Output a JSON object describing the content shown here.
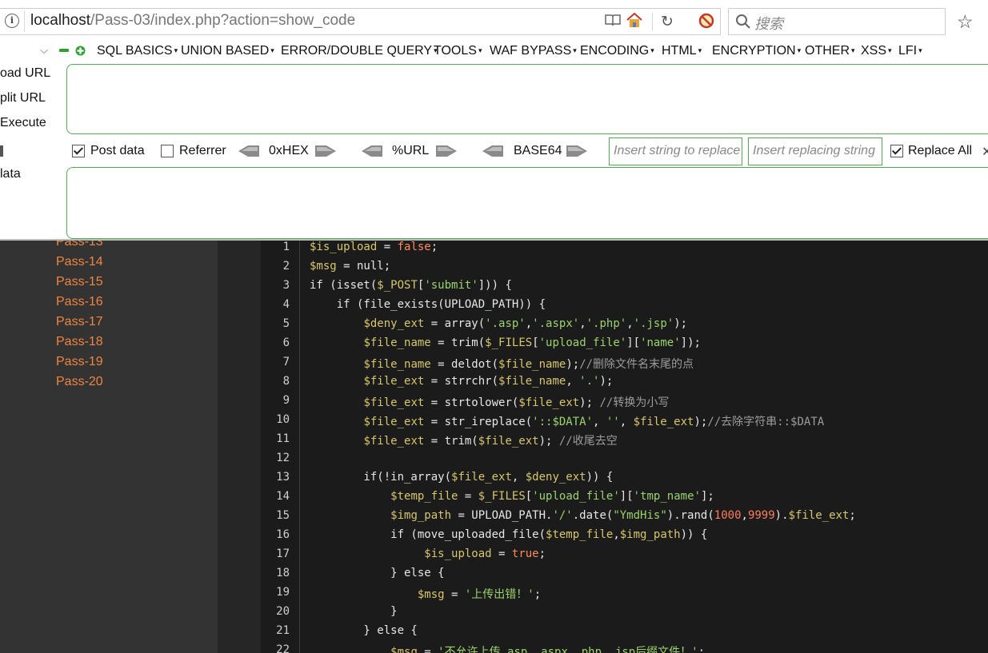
{
  "address_bar": {
    "url_host": "localhost",
    "url_path": "/Pass-03/index.php?action=show_code",
    "search_placeholder": "搜索"
  },
  "hackbar": {
    "menus": [
      "SQL BASICS",
      "UNION BASED",
      "ERROR/DOUBLE QUERY",
      "TOOLS",
      "WAF BYPASS",
      "ENCODING",
      "HTML",
      "ENCRYPTION",
      "OTHER",
      "XSS",
      "LFI"
    ],
    "actions": {
      "load_url": "oad URL",
      "split_url": "plit URL",
      "execute": "Execute",
      "post_data": "lata"
    },
    "options": {
      "post_data": "Post data",
      "referrer": "Referrer",
      "hex": "0xHEX",
      "url": "%URL",
      "base64": "BASE64",
      "replace_from_placeholder": "Insert string to replace",
      "replace_to_placeholder": "Insert replacing string",
      "replace_all": "Replace All"
    },
    "checked": {
      "post_data": true,
      "referrer": false,
      "replace_all": true
    }
  },
  "sidebar": {
    "items": [
      "Pass-13",
      "Pass-14",
      "Pass-15",
      "Pass-16",
      "Pass-17",
      "Pass-18",
      "Pass-19",
      "Pass-20"
    ]
  },
  "code": {
    "line_numbers": [
      "1",
      "2",
      "3",
      "4",
      "5",
      "6",
      "7",
      "8",
      "9",
      "10",
      "11",
      "12",
      "13",
      "14",
      "15",
      "16",
      "17",
      "18",
      "19",
      "20",
      "21",
      "22"
    ],
    "t": {
      "l1a": "$is_upload",
      "l1b": " = ",
      "l1c": "false",
      "l1d": ";",
      "l2a": "$msg",
      "l2b": " = null;",
      "l3a": "if (isset(",
      "l3b": "$_POST",
      "l3c": "[",
      "l3d": "'submit'",
      "l3e": "])) {",
      "l4a": "    if (file_exists(UPLOAD_PATH)) {",
      "l5a": "        ",
      "l5b": "$deny_ext",
      "l5c": " = array(",
      "l5d": "'.asp'",
      "l5e": ",",
      "l5f": "'.aspx'",
      "l5g": ",",
      "l5h": "'.php'",
      "l5i": ",",
      "l5j": "'.jsp'",
      "l5k": ");",
      "l6a": "        ",
      "l6b": "$file_name",
      "l6c": " = trim(",
      "l6d": "$_FILES",
      "l6e": "[",
      "l6f": "'upload_file'",
      "l6g": "][",
      "l6h": "'name'",
      "l6i": "]);",
      "l7a": "        ",
      "l7b": "$file_name",
      "l7c": " = deldot(",
      "l7d": "$file_name",
      "l7e": ");",
      "l7f": "//删除文件名末尾的点",
      "l8a": "        ",
      "l8b": "$file_ext",
      "l8c": " = strrchr(",
      "l8d": "$file_name",
      "l8e": ", ",
      "l8f": "'.'",
      "l8g": ");",
      "l9a": "        ",
      "l9b": "$file_ext",
      "l9c": " = strtolower(",
      "l9d": "$file_ext",
      "l9e": "); ",
      "l9f": "//转换为小写",
      "l10a": "        ",
      "l10b": "$file_ext",
      "l10c": " = str_ireplace(",
      "l10d": "'::$DATA'",
      "l10e": ", ",
      "l10f": "''",
      "l10g": ", ",
      "l10h": "$file_ext",
      "l10i": ");",
      "l10j": "//去除字符串::$DATA",
      "l11a": "        ",
      "l11b": "$file_ext",
      "l11c": " = trim(",
      "l11d": "$file_ext",
      "l11e": "); ",
      "l11f": "//收尾去空",
      "l13a": "        if(!in_array(",
      "l13b": "$file_ext",
      "l13c": ", ",
      "l13d": "$deny_ext",
      "l13e": ")) {",
      "l14a": "            ",
      "l14b": "$temp_file",
      "l14c": " = ",
      "l14d": "$_FILES",
      "l14e": "[",
      "l14f": "'upload_file'",
      "l14g": "][",
      "l14h": "'tmp_name'",
      "l14i": "];",
      "l15a": "            ",
      "l15b": "$img_path",
      "l15c": " = UPLOAD_PATH.",
      "l15d": "'/'",
      "l15e": ".date(",
      "l15f": "\"YmdHis\"",
      "l15g": ").rand(",
      "l15h": "1000",
      "l15i": ",",
      "l15j": "9999",
      "l15k": ").",
      "l15l": "$file_ext",
      "l15m": ";",
      "l16a": "            if (move_uploaded_file(",
      "l16b": "$temp_file",
      "l16c": ",",
      "l16d": "$img_path",
      "l16e": ")) {",
      "l17a": "                 ",
      "l17b": "$is_upload",
      "l17c": " = ",
      "l17d": "true",
      "l17e": ";",
      "l18a": "            } else {",
      "l19a": "                ",
      "l19b": "$msg",
      "l19c": " = ",
      "l19d": "'上传出错！'",
      "l19e": ";",
      "l20a": "            }",
      "l21a": "        } else {",
      "l22a": "            ",
      "l22b": "$msg",
      "l22c": " = ",
      "l22d": "'不允许上传.asp,.aspx,.php,.jsp后缀文件！'",
      "l22e": ";"
    }
  }
}
